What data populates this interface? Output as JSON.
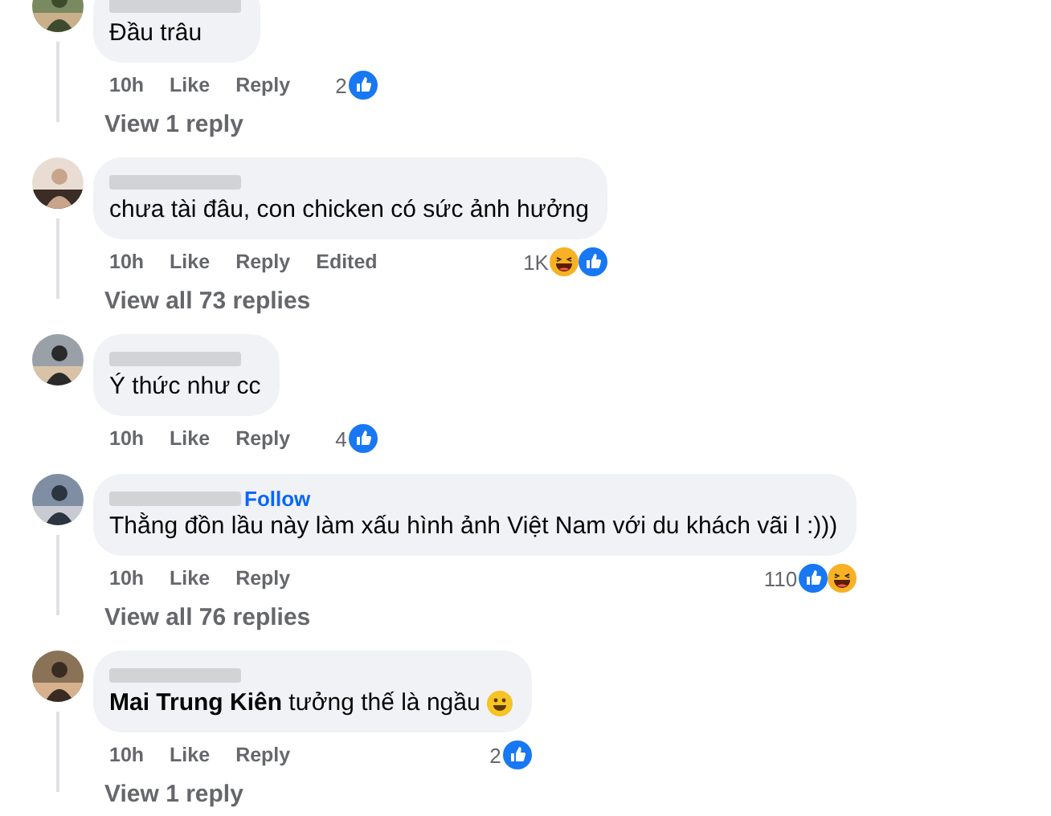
{
  "comments": [
    {
      "text": "Đầu trâu",
      "time": "10h",
      "actions": [
        "Like",
        "Reply"
      ],
      "reaction_count": "2",
      "reactions": [
        {
          "kind": "like"
        }
      ],
      "replies_link": "View 1 reply"
    },
    {
      "text": "chưa tài đâu, con chicken có sức ảnh hưởng",
      "time": "10h",
      "actions": [
        "Like",
        "Reply"
      ],
      "edited": "Edited",
      "reaction_count": "1K",
      "reactions": [
        {
          "kind": "haha"
        },
        {
          "kind": "like"
        }
      ],
      "replies_link": "View all 73 replies"
    },
    {
      "text": "Ý thức như cc",
      "time": "10h",
      "actions": [
        "Like",
        "Reply"
      ],
      "reaction_count": "4",
      "reactions": [
        {
          "kind": "like"
        }
      ]
    },
    {
      "text": "Thằng đồn lầu này làm xấu hình ảnh Việt Nam với du khách vãi l :)))",
      "follow": "Follow",
      "time": "10h",
      "actions": [
        "Like",
        "Reply"
      ],
      "reaction_count": "110",
      "reactions": [
        {
          "kind": "like"
        },
        {
          "kind": "haha"
        }
      ],
      "replies_link": "View all 76 replies"
    },
    {
      "text": "**Mai Trung Kiên** tưởng thế là ngầu",
      "trailing_emoji": true,
      "time": "10h",
      "actions": [
        "Like",
        "Reply"
      ],
      "reaction_count": "2",
      "reactions": [
        {
          "kind": "like"
        }
      ],
      "replies_link": "View 1 reply"
    }
  ]
}
